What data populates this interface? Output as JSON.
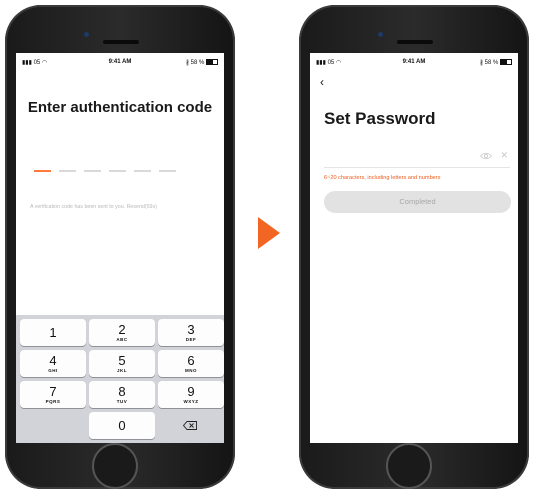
{
  "left_phone": {
    "status": {
      "carrier": "05",
      "time": "9:41 AM",
      "battery": "58 %"
    },
    "title": "Enter authentication code",
    "message": "A verification code has been sent to you. Resend(59s)",
    "keys": [
      {
        "num": "1",
        "sub": ""
      },
      {
        "num": "2",
        "sub": "ABC"
      },
      {
        "num": "3",
        "sub": "DEF"
      },
      {
        "num": "4",
        "sub": "GHI"
      },
      {
        "num": "5",
        "sub": "JKL"
      },
      {
        "num": "6",
        "sub": "MNO"
      },
      {
        "num": "7",
        "sub": "PQRS"
      },
      {
        "num": "8",
        "sub": "TUV"
      },
      {
        "num": "9",
        "sub": "WXYZ"
      },
      {
        "num": "0",
        "sub": ""
      }
    ]
  },
  "arrow": {
    "color": "#f26522"
  },
  "right_phone": {
    "status": {
      "carrier": "05",
      "time": "9:41 AM",
      "battery": "58 %"
    },
    "back_icon": "chevron-left-icon",
    "title": "Set Password",
    "hint": "6~20 characters, including letters and numbers",
    "button": "Completed",
    "accent": "#f05a1a"
  }
}
